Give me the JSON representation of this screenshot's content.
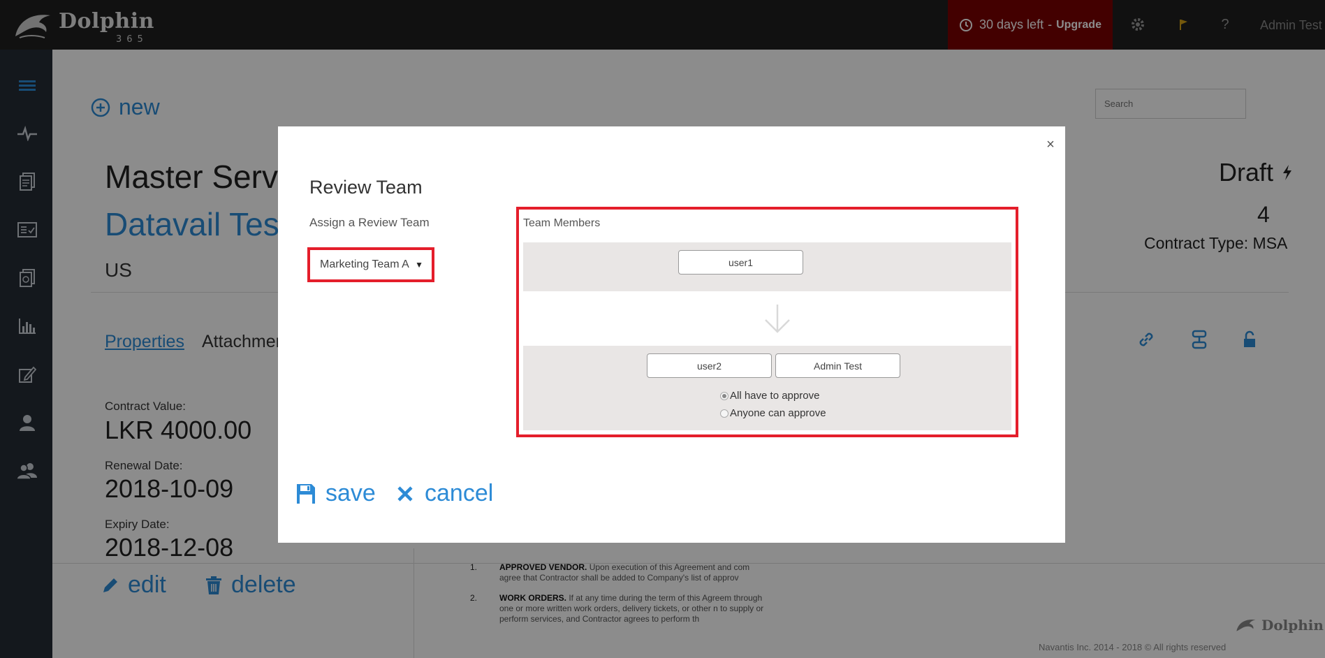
{
  "topbar": {
    "logo_text": "Dolphin",
    "logo_sub": "365",
    "trial_days": "30 days left",
    "trial_sep": "-",
    "upgrade_label": "Upgrade",
    "help_label": "?",
    "user_name": "Admin Test",
    "icons": [
      "clock-icon",
      "gear-icon",
      "flag-icon",
      "help-icon"
    ]
  },
  "sidebar": {
    "items": [
      "menu-icon",
      "activity-icon",
      "documents-icon",
      "inbox-icon",
      "contracts-icon",
      "reports-icon",
      "edit-icon",
      "user-icon",
      "users-icon"
    ]
  },
  "page": {
    "new_label": "new",
    "search_placeholder": "Search",
    "title": "Master Servic",
    "subtitle": "Datavail Test",
    "country": "US",
    "status": "Draft",
    "revision": "4",
    "contract_type": "Contract Type: MSA",
    "tabs": [
      {
        "label": "Properties",
        "active": true
      },
      {
        "label": "Attachmen",
        "active": false
      }
    ],
    "fields": [
      {
        "label": "Contract Value:",
        "value": "LKR 4000.00"
      },
      {
        "label": "Renewal Date:",
        "value": "2018-10-09"
      },
      {
        "label": "Expiry Date:",
        "value": "2018-12-08"
      }
    ],
    "edit_label": "edit",
    "delete_label": "delete",
    "document_clauses": [
      {
        "num": "1.",
        "heading": "APPROVED VENDOR.",
        "text": "Upon execution of this Agreement and com agree that Contractor shall be added to Company's list of approv"
      },
      {
        "num": "2.",
        "heading": "WORK ORDERS.",
        "text": "If at any time during the term of this Agreem through one or more written work orders, delivery tickets, or other n to supply or perform services, and Contractor agrees to perform th"
      }
    ],
    "footer_logo": "Dolphin",
    "footer_text": "Navantis Inc. 2014 - 2018 © All rights reserved"
  },
  "modal": {
    "close_label": "×",
    "title": "Review Team",
    "assign_label": "Assign a Review Team",
    "selected_team": "Marketing Team A",
    "members_label": "Team Members",
    "stages": [
      {
        "members": [
          "user1"
        ]
      },
      {
        "members": [
          "user2",
          "Admin Test"
        ]
      }
    ],
    "approval_options": [
      {
        "label": "All have to approve",
        "checked": true
      },
      {
        "label": "Anyone can approve",
        "checked": false
      }
    ],
    "save_label": "save",
    "cancel_label": "cancel"
  },
  "colors": {
    "accent": "#2d8bd6",
    "topbar": "#1f1f1f",
    "sidebar": "#262c35",
    "trial": "#7a0000",
    "highlight": "#e41e2b"
  }
}
